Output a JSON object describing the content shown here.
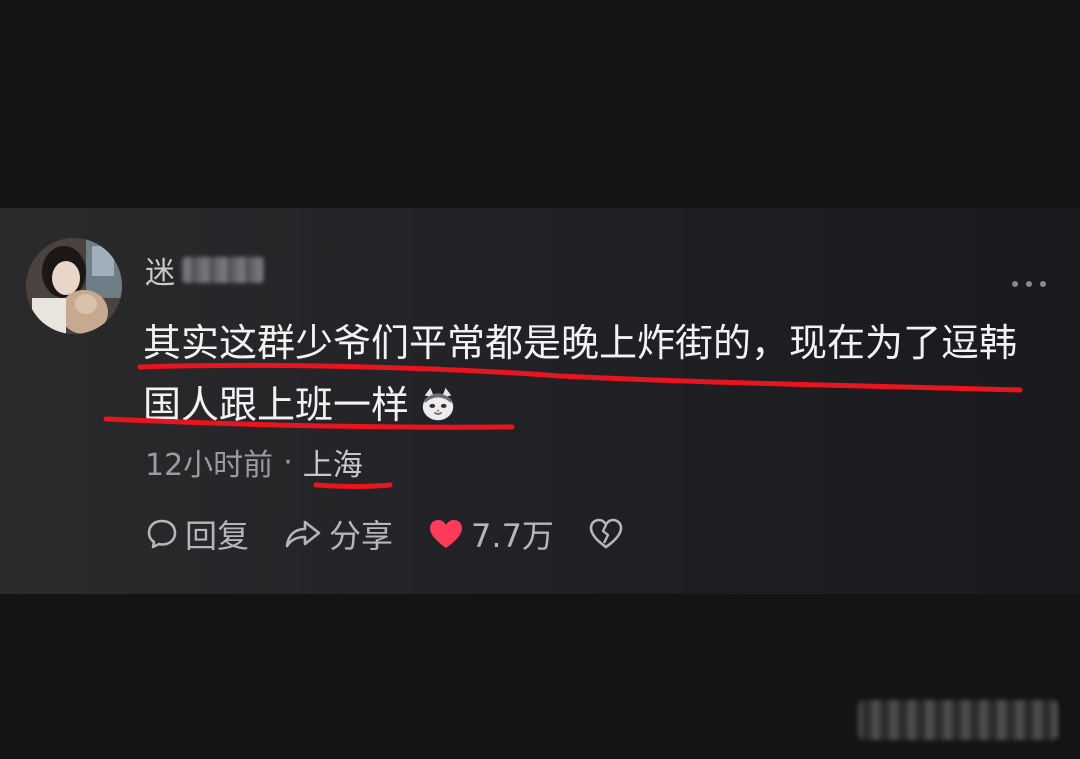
{
  "comment": {
    "username_visible": "迷",
    "text_line1": "其实这群少爷们平常都是晚上炸街的，现在为了逗韩",
    "text_line2": "国人跟上班一样",
    "emoji_icon": "cat-face-icon",
    "time": "12小时前",
    "separator": "·",
    "location": "上海"
  },
  "actions": {
    "reply_label": "回复",
    "share_label": "分享",
    "likes_count": "7.7万"
  },
  "colors": {
    "background": "#141417",
    "card": "#242428",
    "text": "#f2f2f4",
    "meta": "#9a9aa0",
    "like": "#ff3b5c",
    "annotation": "#e8141e"
  }
}
